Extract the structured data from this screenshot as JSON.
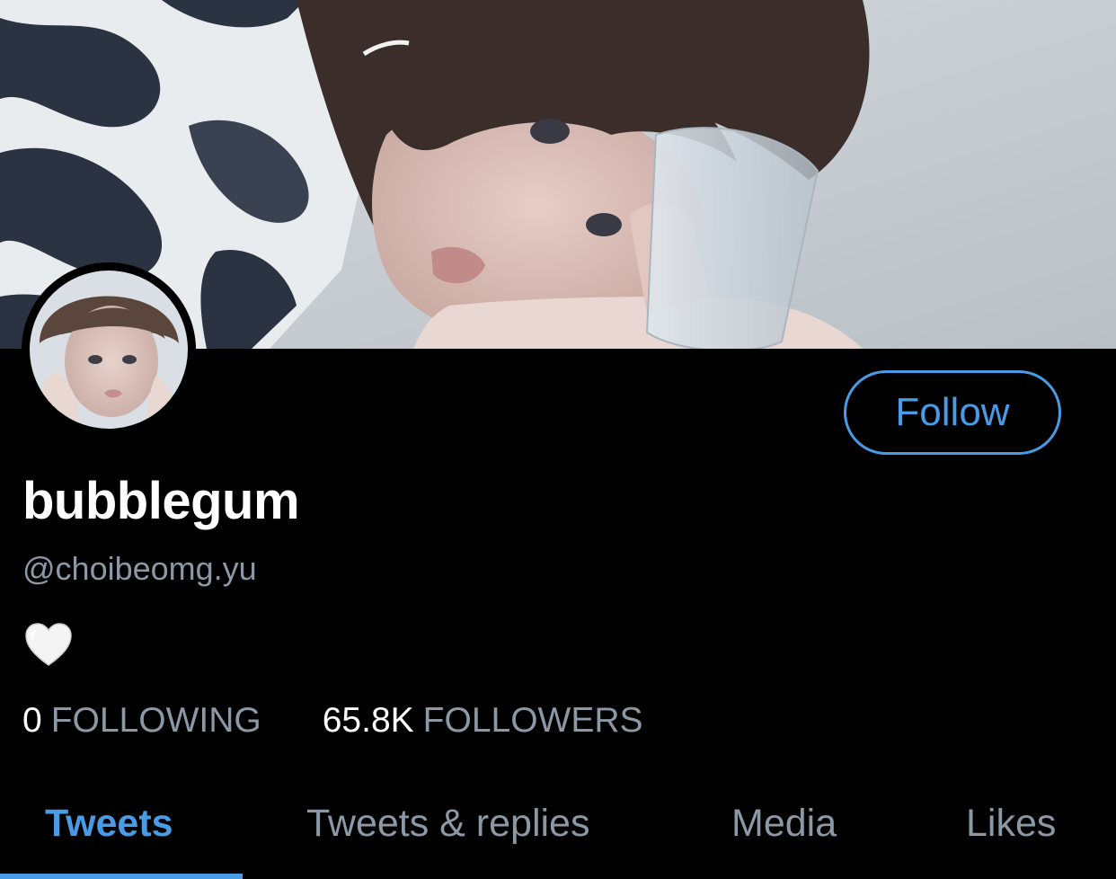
{
  "profile": {
    "display_name": "bubblegum",
    "handle": "@choibeomg.yu",
    "bio_emoji": "white-heart",
    "follow_label": "Follow"
  },
  "stats": {
    "following_count": "0",
    "following_label": "FOLLOWING",
    "followers_count": "65.8K",
    "followers_label": "FOLLOWERS"
  },
  "tabs": [
    {
      "label": "Tweets",
      "active": true
    },
    {
      "label": "Tweets & replies",
      "active": false
    },
    {
      "label": "Media",
      "active": false
    },
    {
      "label": "Likes",
      "active": false
    }
  ],
  "colors": {
    "background": "#000000",
    "accent": "#4a9be6",
    "secondary_text": "#8b98a5",
    "primary_text": "#ffffff"
  }
}
